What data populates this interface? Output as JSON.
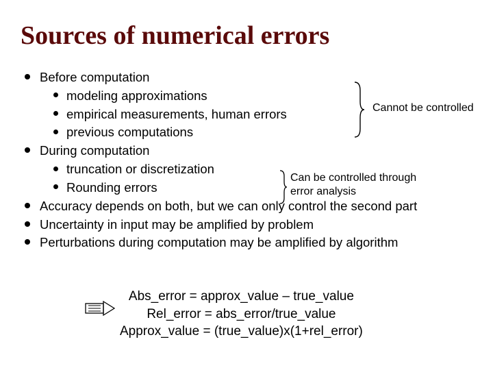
{
  "title": "Sources of numerical errors",
  "bullets": {
    "b1": "Before computation",
    "b1a": "modeling approximations",
    "b1b": "empirical measurements, human errors",
    "b1c": "previous computations",
    "b2": "During computation",
    "b2a": "truncation or discretization",
    "b2b": "Rounding errors",
    "b3": "Accuracy depends on both, but we can only control the second part",
    "b4": "Uncertainty in input may be amplified by problem",
    "b5": "Perturbations during computation may be amplified by algorithm"
  },
  "notes": {
    "cannot": "Cannot be controlled",
    "can_line1": "Can be controlled through",
    "can_line2": "error analysis"
  },
  "formulas": {
    "f1": "Abs_error = approx_value – true_value",
    "f2": "Rel_error = abs_error/true_value",
    "f3": "Approx_value = (true_value)x(1+rel_error)"
  }
}
